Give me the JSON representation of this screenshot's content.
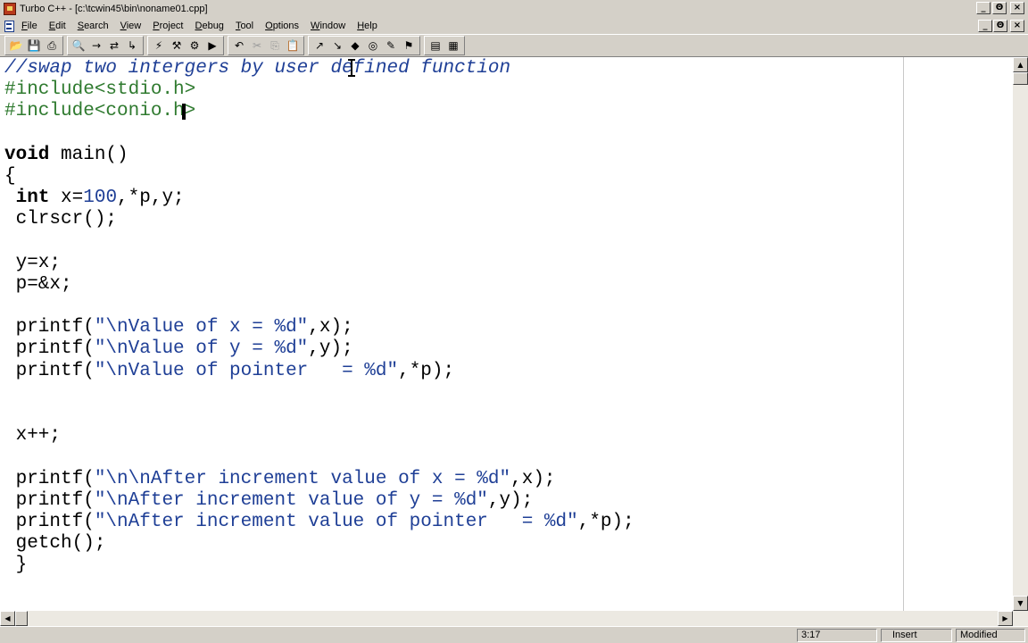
{
  "window": {
    "title": "Turbo C++ - [c:\\tcwin45\\bin\\noname01.cpp]",
    "controls": [
      "_",
      "Θ",
      "×"
    ]
  },
  "menubar": {
    "items": [
      {
        "first": "F",
        "rest": "ile"
      },
      {
        "first": "E",
        "rest": "dit"
      },
      {
        "first": "S",
        "rest": "earch"
      },
      {
        "first": "V",
        "rest": "iew"
      },
      {
        "first": "P",
        "rest": "roject"
      },
      {
        "first": "D",
        "rest": "ebug"
      },
      {
        "first": "T",
        "rest": "ool"
      },
      {
        "first": "O",
        "rest": "ptions"
      },
      {
        "first": "W",
        "rest": "indow"
      },
      {
        "first": "H",
        "rest": "elp"
      }
    ],
    "doc_controls": [
      "_",
      "Θ",
      "×"
    ]
  },
  "toolbar": {
    "groups": [
      [
        {
          "icon": "open-folder-icon",
          "glyph": "📂"
        },
        {
          "icon": "save-icon",
          "glyph": "💾"
        },
        {
          "icon": "print-icon",
          "glyph": "⎙"
        }
      ],
      [
        {
          "icon": "find-icon",
          "glyph": "🔍"
        },
        {
          "icon": "find-next-icon",
          "glyph": "→"
        },
        {
          "icon": "replace-icon",
          "glyph": "⇄"
        },
        {
          "icon": "goto-icon",
          "glyph": "↳"
        }
      ],
      [
        {
          "icon": "compile-icon",
          "glyph": "⚡"
        },
        {
          "icon": "make-icon",
          "glyph": "⚒"
        },
        {
          "icon": "build-icon",
          "glyph": "⚙"
        },
        {
          "icon": "run-icon",
          "glyph": "▶"
        }
      ],
      [
        {
          "icon": "undo-icon",
          "glyph": "↶"
        },
        {
          "icon": "cut-icon",
          "glyph": "✂",
          "disabled": true
        },
        {
          "icon": "copy-icon",
          "glyph": "⎘",
          "disabled": true
        },
        {
          "icon": "paste-icon",
          "glyph": "📋"
        }
      ],
      [
        {
          "icon": "step-icon",
          "glyph": "↗"
        },
        {
          "icon": "trace-icon",
          "glyph": "↘"
        },
        {
          "icon": "breakpoint-icon",
          "glyph": "◆"
        },
        {
          "icon": "watch-icon",
          "glyph": "◎"
        },
        {
          "icon": "inspect-icon",
          "glyph": "✎"
        },
        {
          "icon": "evaluate-icon",
          "glyph": "⚑"
        }
      ],
      [
        {
          "icon": "window-tile-icon",
          "glyph": "▤"
        },
        {
          "icon": "window-cascade-icon",
          "glyph": "▦"
        }
      ]
    ]
  },
  "editor": {
    "lines": [
      [
        {
          "t": "//swap two intergers by user defined function",
          "c": "cmt"
        }
      ],
      [
        {
          "t": "#include<stdio.h>",
          "c": "pre"
        }
      ],
      [
        {
          "t": "#include<conio.h>",
          "c": "pre"
        }
      ],
      [],
      [
        {
          "t": "void",
          "c": "kw"
        },
        {
          "t": " main()",
          "c": ""
        }
      ],
      [
        {
          "t": "{",
          "c": ""
        }
      ],
      [
        {
          "t": " ",
          "c": ""
        },
        {
          "t": "int",
          "c": "kw"
        },
        {
          "t": " x=",
          "c": ""
        },
        {
          "t": "100",
          "c": "num"
        },
        {
          "t": ",*p,y;",
          "c": ""
        }
      ],
      [
        {
          "t": " clrscr();",
          "c": ""
        }
      ],
      [],
      [
        {
          "t": " y=x;",
          "c": ""
        }
      ],
      [
        {
          "t": " p=&x;",
          "c": ""
        }
      ],
      [],
      [
        {
          "t": " printf(",
          "c": ""
        },
        {
          "t": "\"\\nValue of x = %d\"",
          "c": "str"
        },
        {
          "t": ",x);",
          "c": ""
        }
      ],
      [
        {
          "t": " printf(",
          "c": ""
        },
        {
          "t": "\"\\nValue of y = %d\"",
          "c": "str"
        },
        {
          "t": ",y);",
          "c": ""
        }
      ],
      [
        {
          "t": " printf(",
          "c": ""
        },
        {
          "t": "\"\\nValue of pointer   = %d\"",
          "c": "str"
        },
        {
          "t": ",*p);",
          "c": ""
        }
      ],
      [],
      [],
      [
        {
          "t": " x++;",
          "c": ""
        }
      ],
      [],
      [
        {
          "t": " printf(",
          "c": ""
        },
        {
          "t": "\"\\n\\nAfter increment value of x = %d\"",
          "c": "str"
        },
        {
          "t": ",x);",
          "c": ""
        }
      ],
      [
        {
          "t": " printf(",
          "c": ""
        },
        {
          "t": "\"\\nAfter increment value of y = %d\"",
          "c": "str"
        },
        {
          "t": ",y);",
          "c": ""
        }
      ],
      [
        {
          "t": " printf(",
          "c": ""
        },
        {
          "t": "\"\\nAfter increment value of pointer   = %d\"",
          "c": "str"
        },
        {
          "t": ",*p);",
          "c": ""
        }
      ],
      [
        {
          "t": " getch();",
          "c": ""
        }
      ],
      [
        {
          "t": " }",
          "c": ""
        }
      ]
    ]
  },
  "scrollbars": {
    "up": "▲",
    "down": "▼",
    "left": "◀",
    "right": "▶"
  },
  "statusbar": {
    "position": "3:17",
    "mode": "Insert",
    "state": "Modified"
  }
}
